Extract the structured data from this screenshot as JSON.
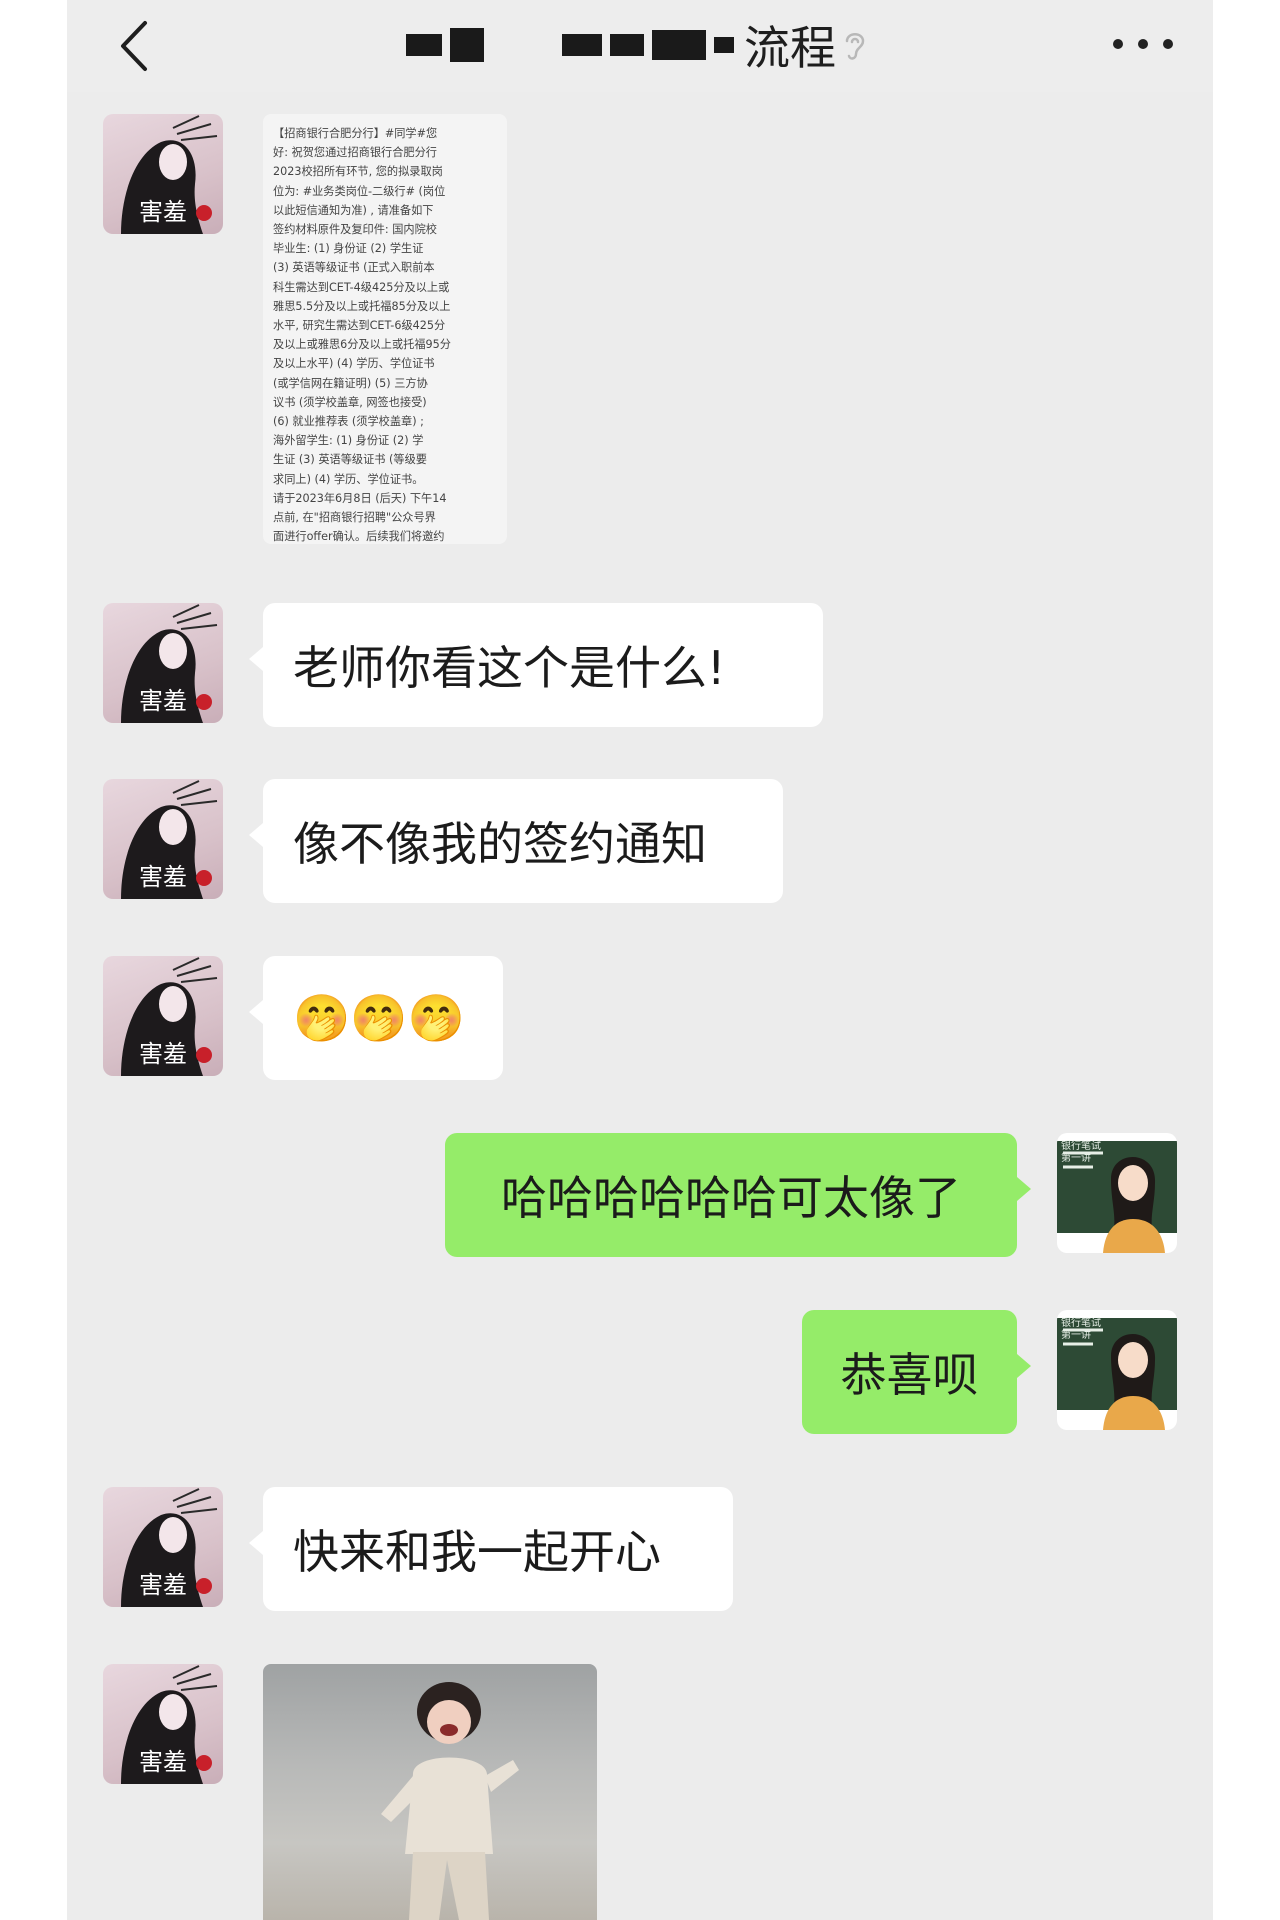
{
  "nav": {
    "title_suffix": "流程",
    "back_icon": "chevron-left-icon",
    "more_icon": "ellipsis-icon"
  },
  "sms": {
    "lines": [
      "【招商银行合肥分行】#同学#您",
      "好: 祝贺您通过招商银行合肥分行",
      "2023校招所有环节, 您的拟录取岗",
      "位为: #业务类岗位-二级行# (岗位",
      "以此短信通知为准) , 请准备如下",
      "签约材料原件及复印件: 国内院校",
      "毕业生: (1) 身份证 (2) 学生证",
      "(3) 英语等级证书 (正式入职前本",
      "科生需达到CET-4级425分及以上或",
      "雅思5.5分及以上或托福85分及以上",
      "水平, 研究生需达到CET-6级425分",
      "及以上或雅思6分及以上或托福95分",
      "及以上水平) (4) 学历、学位证书",
      "(或学信网在籍证明) (5) 三方协",
      "议书 (须学校盖章, 网签也接受)",
      "(6) 就业推荐表 (须学校盖章) ;",
      "海外留学生: (1) 身份证 (2) 学",
      "生证 (3) 英语等级证书 (等级要",
      "求同上) (4) 学历、学位证书。",
      "请于2023年6月8日 (后天) 下午14",
      "点前, 在\"招商银行招聘\"公众号界",
      "面进行offer确认。后续我们将邀约"
    ]
  },
  "messages": [
    {
      "side": "in",
      "text": "老师你看这个是什么!"
    },
    {
      "side": "in",
      "text": "像不像我的签约通知"
    },
    {
      "side": "in",
      "emoji": "🤭🤭🤭"
    },
    {
      "side": "out",
      "text": "哈哈哈哈哈哈可太像了"
    },
    {
      "side": "out",
      "text": "恭喜呗"
    },
    {
      "side": "in",
      "text": "快来和我一起开心"
    }
  ],
  "avatars": {
    "left_caption": "害羞",
    "right_caption": "银行笔试 第一讲"
  },
  "colors": {
    "chat_bg": "#ececec",
    "bubble_in": "#ffffff",
    "bubble_out": "#95ec69",
    "link": "#3a8fd6"
  }
}
